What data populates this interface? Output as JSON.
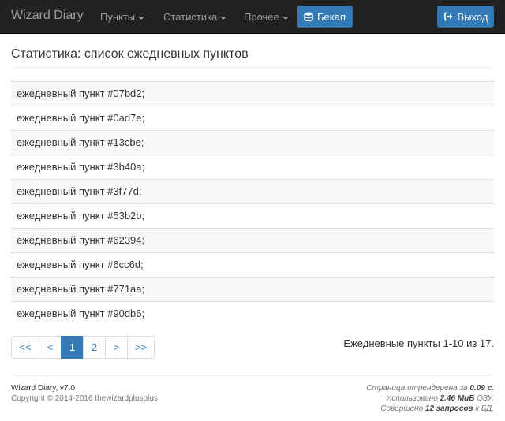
{
  "navbar": {
    "brand": "Wizard Diary",
    "menus": [
      {
        "label": "Пункты"
      },
      {
        "label": "Статистика"
      },
      {
        "label": "Прочее"
      }
    ],
    "backup_label": "Бекап",
    "logout_label": "Выход"
  },
  "page": {
    "title": "Статистика: список ежедневных пунктов"
  },
  "items": [
    "ежедневный пункт #07bd2;",
    "ежедневный пункт #0ad7e;",
    "ежедневный пункт #13cbe;",
    "ежедневный пункт #3b40a;",
    "ежедневный пункт #3f77d;",
    "ежедневный пункт #53b2b;",
    "ежедневный пункт #62394;",
    "ежедневный пункт #6cc6d;",
    "ежедневный пункт #771aa;",
    "ежедневный пункт #90db6;"
  ],
  "pagination": {
    "first": "<<",
    "prev": "<",
    "pages": [
      "1",
      "2"
    ],
    "active_page": "1",
    "next": ">",
    "last": ">>",
    "summary": "Ежедневные пункты 1-10 из 17."
  },
  "footer": {
    "app": "Wizard Diary",
    "version": "v7.0",
    "copyright": "Copyright © 2014-2016 thewizardplusplus",
    "render_prefix": "Страница отрендерена за",
    "render_time": "0.09 с.",
    "memory_prefix": "Использовано",
    "memory": "2.46 МиБ",
    "memory_suffix": "ОЗУ.",
    "queries_prefix": "Совершено",
    "queries": "12 запросов",
    "queries_suffix": "к БД."
  },
  "colors": {
    "navbar_bg": "#222222",
    "primary": "#337ab7",
    "stripe": "#f9f9f9"
  },
  "icons": [
    "database-icon",
    "sign-out-icon",
    "caret-down-icon"
  ]
}
